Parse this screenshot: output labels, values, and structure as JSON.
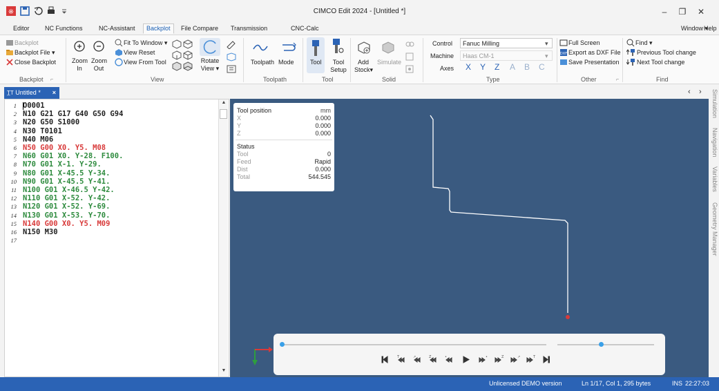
{
  "window": {
    "title": "CIMCO Edit 2024 - [Untitled *]",
    "help_label": "Help",
    "window_menu_label": "Window"
  },
  "menu": [
    {
      "label": "Editor"
    },
    {
      "label": "NC Functions"
    },
    {
      "label": "NC-Assistant"
    },
    {
      "label": "Backplot",
      "active": true
    },
    {
      "label": "File Compare"
    },
    {
      "label": "Transmission"
    },
    {
      "label": "CNC-Calc"
    }
  ],
  "ribbon": {
    "backplot_group": {
      "label": "Backplot",
      "items": [
        "Backplot",
        "Backplot File",
        "Close Backplot"
      ]
    },
    "view_group": {
      "label": "View",
      "zoom_in_1": "Zoom",
      "zoom_in_2": "In",
      "zoom_out_1": "Zoom",
      "zoom_out_2": "Out",
      "fit_to_window": "Fit To Window",
      "view_reset": "View Reset",
      "view_from_tool": "View From Tool",
      "rotate_1": "Rotate",
      "rotate_2": "View"
    },
    "toolpath_group": {
      "label": "Toolpath",
      "toolpath": "Toolpath",
      "mode": "Mode"
    },
    "tool_group": {
      "label": "Tool",
      "tool": "Tool",
      "setup_1": "Tool",
      "setup_2": "Setup"
    },
    "solid_group": {
      "label": "Solid",
      "add_1": "Add",
      "add_2": "Stock",
      "simulate": "Simulate"
    },
    "type_group": {
      "label": "Type",
      "control_label": "Control",
      "control_value": "Fanuc Milling",
      "machine_label": "Machine",
      "machine_value": "Haas CM-1",
      "axes_label": "Axes",
      "axes": [
        "X",
        "Y",
        "Z",
        "A",
        "B",
        "C"
      ]
    },
    "other_group": {
      "label": "Other",
      "full_screen": "Full Screen",
      "export_dxf": "Export as DXF File",
      "save_presentation": "Save Presentation"
    },
    "find_group": {
      "label": "Find",
      "find": "Find",
      "previous_tool_change": "Previous Tool change",
      "next_tool_change": "Next Tool change"
    }
  },
  "tab": {
    "label": "Untitled *"
  },
  "code_lines": [
    {
      "n": "1",
      "text": "O0001",
      "color": "#222222"
    },
    {
      "n": "2",
      "text": "N10 G21 G17 G40 G50 G94",
      "color": "#222222"
    },
    {
      "n": "3",
      "text": "N20 G50 S1000",
      "color": "#222222"
    },
    {
      "n": "4",
      "text": "N30 T0101",
      "color": "#222222"
    },
    {
      "n": "5",
      "text": "N40 M06",
      "color": "#222222"
    },
    {
      "n": "6",
      "text": "N50 G00 X0. Y5. M08",
      "color": "#d83a3a"
    },
    {
      "n": "7",
      "text": "N60 G01 X0. Y-28. F100.",
      "color": "#2e8b3e"
    },
    {
      "n": "8",
      "text": "N70 G01 X-1. Y-29.",
      "color": "#2e8b3e"
    },
    {
      "n": "9",
      "text": "N80 G01 X-45.5 Y-34.",
      "color": "#2e8b3e"
    },
    {
      "n": "10",
      "text": "N90 G01 X-45.5 Y-41.",
      "color": "#2e8b3e"
    },
    {
      "n": "11",
      "text": "N100 G01 X-46.5 Y-42.",
      "color": "#2e8b3e"
    },
    {
      "n": "12",
      "text": "N110 G01 X-52. Y-42.",
      "color": "#2e8b3e"
    },
    {
      "n": "13",
      "text": "N120 G01 X-52. Y-69.",
      "color": "#2e8b3e"
    },
    {
      "n": "14",
      "text": "N130 G01 X-53. Y-70.",
      "color": "#2e8b3e"
    },
    {
      "n": "15",
      "text": "N140 G00 X0. Y5. M09",
      "color": "#d83a3a"
    },
    {
      "n": "16",
      "text": "N150 M30",
      "color": "#222222"
    },
    {
      "n": "17",
      "text": "",
      "color": "#222222"
    }
  ],
  "tool_position": {
    "title": "Tool position",
    "unit": "mm",
    "x_label": "X",
    "x": "0.000",
    "y_label": "Y",
    "y": "0.000",
    "z_label": "Z",
    "z": "0.000",
    "status_title": "Status",
    "tool_label": "Tool",
    "tool": "0",
    "feed_label": "Feed",
    "feed": "Rapid",
    "dist_label": "Dist",
    "dist": "0.000",
    "total_label": "Total",
    "total": "544.545"
  },
  "playback": {
    "progress": 0.0,
    "speed": 0.45
  },
  "side_tabs": [
    "Simulation",
    "Navigation",
    "Variables",
    "Geometry Manager"
  ],
  "status": {
    "license": "Unlicensed DEMO version",
    "position": "Ln 1/17, Col 1, 295 bytes",
    "mode": "INS",
    "time": "22:27:03"
  },
  "colors": {
    "accent": "#2b63b5",
    "viewport": "#3a5a80",
    "rapid": "#d83a3a",
    "feed": "#2e8b3e"
  }
}
